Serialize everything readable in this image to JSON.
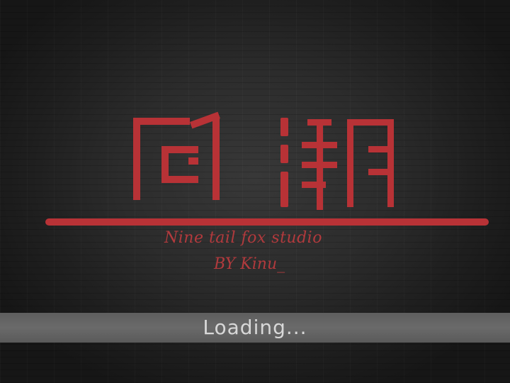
{
  "app": {
    "title_chars": "风潮",
    "studio": "Nine tail fox studio",
    "author": "BY Kinu_"
  },
  "loading": {
    "label": "Loading...",
    "bar_color": "#666666"
  },
  "colors": {
    "accent": "#b83236",
    "background": "#2b2b2b",
    "loading_text": "#d8d8d8"
  }
}
